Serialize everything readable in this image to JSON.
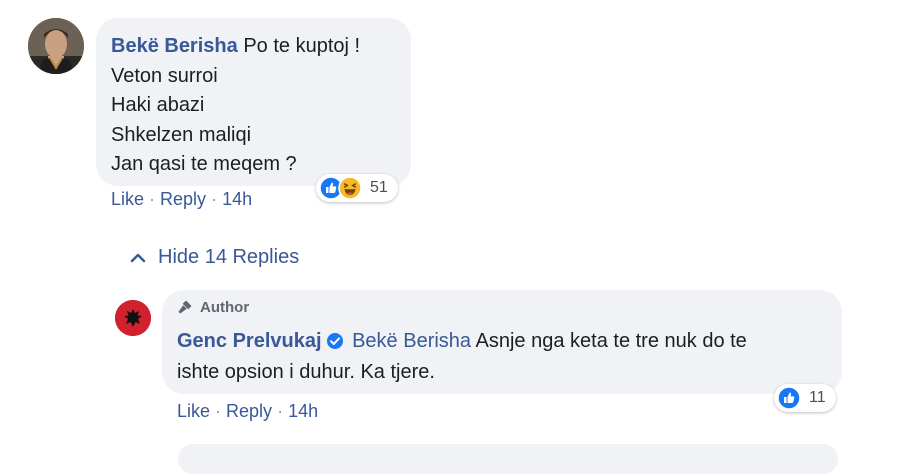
{
  "comments": [
    {
      "author": "Bekë Berisha",
      "lines": [
        "Po te kuptoj !",
        "Veton surroi",
        "Haki abazi",
        "Shkelzen maliqi",
        "Jan qasi te meqem ?"
      ],
      "actions": {
        "like": "Like",
        "reply": "Reply",
        "separator": "·",
        "time": "14h"
      },
      "reactions": {
        "icons": [
          "like-icon",
          "haha-icon"
        ],
        "count": "51"
      }
    }
  ],
  "hide_replies_label": "Hide 14 Replies",
  "reply": {
    "badge": "Author",
    "author": "Genc Prelvukaj",
    "verified": true,
    "mention": "Bekë Berisha",
    "text_first": "Asnje nga keta te tre nuk do te",
    "text_second": "ishte opsion i duhur. Ka tjere.",
    "actions": {
      "like": "Like",
      "reply": "Reply",
      "separator": "·",
      "time": "14h"
    },
    "reactions": {
      "icons": [
        "like-icon"
      ],
      "count": "11"
    }
  },
  "colors": {
    "link_blue": "#385898",
    "bubble_bg": "#f0f2f5",
    "like_blue": "#1877f2",
    "haha_yellow": "#f7b928",
    "flag_red": "#d2202e"
  }
}
